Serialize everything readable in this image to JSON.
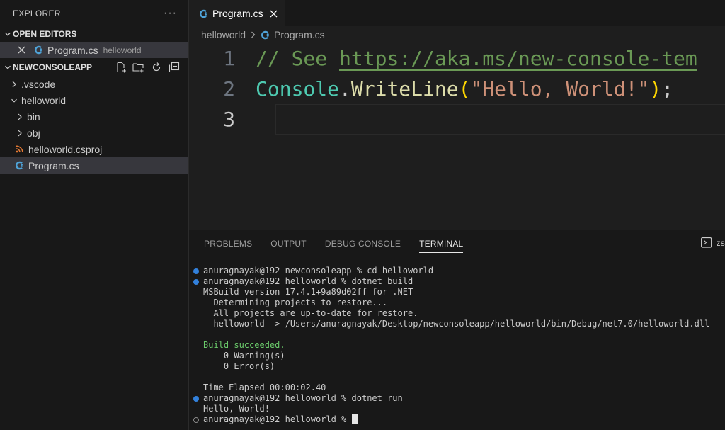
{
  "sidebar": {
    "title": "EXPLORER",
    "more": "···",
    "open_editors": {
      "label": "OPEN EDITORS",
      "items": [
        {
          "name": "Program.cs",
          "description": "helloworld"
        }
      ]
    },
    "folder": {
      "label": "NEWCONSOLEAPP",
      "items": [
        {
          "name": ".vscode",
          "type": "folder",
          "state": "collapsed"
        },
        {
          "name": "helloworld",
          "type": "folder",
          "state": "expanded"
        },
        {
          "name": "bin",
          "type": "folder",
          "state": "collapsed"
        },
        {
          "name": "obj",
          "type": "folder",
          "state": "collapsed"
        },
        {
          "name": "helloworld.csproj",
          "type": "file",
          "icon": "rss-icon"
        },
        {
          "name": "Program.cs",
          "type": "file",
          "icon": "csharp-icon",
          "selected": true
        }
      ]
    }
  },
  "editor": {
    "tab": {
      "label": "Program.cs"
    },
    "breadcrumb": {
      "folder": "helloworld",
      "file": "Program.cs"
    },
    "lines": [
      {
        "number": "1",
        "comment": "// See ",
        "link": "https://aka.ms/new-console-tem"
      },
      {
        "number": "2",
        "class": "Console",
        "dot": ".",
        "method": "WriteLine",
        "paren_open": "(",
        "string": "\"Hello, World!\"",
        "paren_close": ")",
        "semi": ";"
      },
      {
        "number": "3"
      }
    ]
  },
  "panel": {
    "tabs": [
      "PROBLEMS",
      "OUTPUT",
      "DEBUG CONSOLE",
      "TERMINAL"
    ],
    "active_tab": "TERMINAL",
    "shell_label": "zs",
    "terminal": [
      {
        "text": "anuragnayak@192 newconsoleapp % cd helloworld",
        "marker": "blue"
      },
      {
        "text": "anuragnayak@192 helloworld % dotnet build",
        "marker": "blue"
      },
      {
        "text": "MSBuild version 17.4.1+9a89d02ff for .NET",
        "marker": ""
      },
      {
        "text": "  Determining projects to restore...",
        "marker": ""
      },
      {
        "text": "  All projects are up-to-date for restore.",
        "marker": ""
      },
      {
        "text": "  helloworld -> /Users/anuragnayak/Desktop/newconsoleapp/helloworld/bin/Debug/net7.0/helloworld.dll",
        "marker": ""
      },
      {
        "text": "",
        "marker": ""
      },
      {
        "text": "Build succeeded.",
        "marker": "",
        "style": "green"
      },
      {
        "text": "    0 Warning(s)",
        "marker": ""
      },
      {
        "text": "    0 Error(s)",
        "marker": ""
      },
      {
        "text": "",
        "marker": ""
      },
      {
        "text": "Time Elapsed 00:00:02.40",
        "marker": ""
      },
      {
        "text": "anuragnayak@192 helloworld % dotnet run",
        "marker": "blue"
      },
      {
        "text": "Hello, World!",
        "marker": ""
      },
      {
        "text": "anuragnayak@192 helloworld % ",
        "marker": "hollow",
        "cursor": true
      }
    ]
  },
  "colors": {
    "background": "#1e1e1e",
    "sidebar": "#181818",
    "comment": "#6a9955",
    "class": "#4ec9b0",
    "method": "#dcdcaa",
    "string": "#ce9178",
    "bracket": "#ffd700",
    "accent_blue": "#3794ff",
    "csproj_icon": "#e37933"
  }
}
